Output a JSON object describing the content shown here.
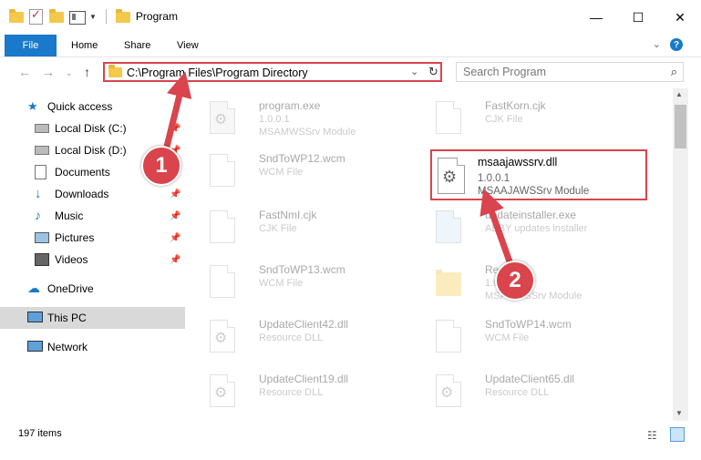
{
  "window": {
    "title": "Program",
    "minimize": "—",
    "maximize": "☐",
    "close": "✕"
  },
  "ribbon": {
    "file": "File",
    "tabs": [
      "Home",
      "Share",
      "View"
    ],
    "help": "?"
  },
  "address": {
    "path": "C:\\Program Files\\Program Directory",
    "search_placeholder": "Search Program"
  },
  "nav": {
    "quick_access": "Quick access",
    "items": [
      {
        "label": "Local Disk (C:)",
        "icon": "drive-icon",
        "pinned": true
      },
      {
        "label": "Local Disk (D:)",
        "icon": "drive-icon",
        "pinned": true
      },
      {
        "label": "Documents",
        "icon": "documents-icon",
        "pinned": true
      },
      {
        "label": "Downloads",
        "icon": "downloads-icon",
        "pinned": true
      },
      {
        "label": "Music",
        "icon": "music-icon",
        "pinned": true
      },
      {
        "label": "Pictures",
        "icon": "pictures-icon",
        "pinned": true
      },
      {
        "label": "Videos",
        "icon": "videos-icon",
        "pinned": true
      }
    ],
    "onedrive": "OneDrive",
    "this_pc": "This PC",
    "network": "Network"
  },
  "files": {
    "left": [
      {
        "name": "program.exe",
        "sub": "1.0.0.1",
        "sub2": "MSAMWSSrv Module",
        "icon": "exe-icon"
      },
      {
        "name": "SndToWP12.wcm",
        "sub": "WCM File",
        "sub2": "",
        "icon": "file-icon"
      },
      {
        "name": "FastNmI.cjk",
        "sub": "CJK File",
        "sub2": "",
        "icon": "file-icon"
      },
      {
        "name": "SndToWP13.wcm",
        "sub": "WCM File",
        "sub2": "",
        "icon": "file-icon"
      },
      {
        "name": "UpdateClient42.dll",
        "sub": "Resource DLL",
        "sub2": "",
        "icon": "dll-icon"
      },
      {
        "name": "UpdateClient19.dll",
        "sub": "Resource DLL",
        "sub2": "",
        "icon": "dll-icon"
      }
    ],
    "right": [
      {
        "name": "FastKorn.cjk",
        "sub": "CJK File",
        "sub2": "",
        "icon": "file-icon"
      },
      {
        "name": "",
        "sub": "",
        "sub2": "",
        "icon": "none"
      },
      {
        "name": "updateinstaller.exe",
        "sub": "ABBY updates installer",
        "sub2": "",
        "icon": "installer-icon"
      },
      {
        "name": "Resource",
        "sub": "1.0.0.1",
        "sub2": "MSAMWSSrv Module",
        "icon": "folder-icon"
      },
      {
        "name": "SndToWP14.wcm",
        "sub": "WCM File",
        "sub2": "",
        "icon": "file-icon"
      },
      {
        "name": "UpdateClient65.dll",
        "sub": "Resource DLL",
        "sub2": "",
        "icon": "dll-icon"
      }
    ],
    "highlighted": {
      "name": "msaajawssrv.dll",
      "version": "1.0.0.1",
      "description": "MSAAJAWSSrv Module"
    }
  },
  "status": {
    "count": "197 items"
  },
  "annotations": {
    "badge1": "1",
    "badge2": "2",
    "color": "#d9444d"
  }
}
